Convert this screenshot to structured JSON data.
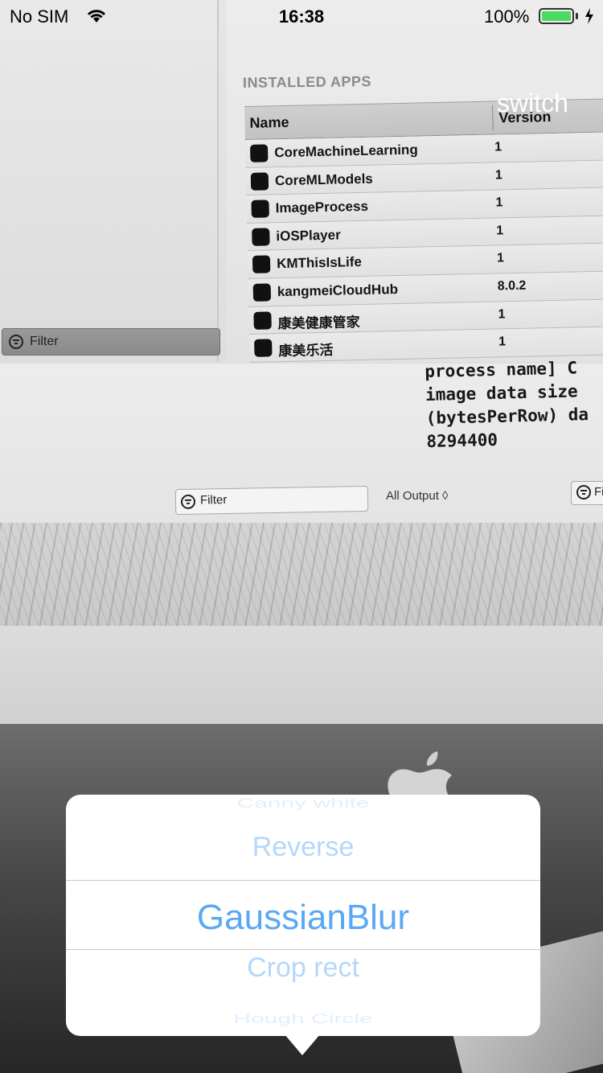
{
  "status_bar": {
    "carrier": "No SIM",
    "time": "16:38",
    "battery_percent": "100%",
    "battery_color": "#4cd964"
  },
  "switch_label": "switch",
  "camera_scene": {
    "section_title": "INSTALLED APPS",
    "table": {
      "columns": [
        "Name",
        "Version"
      ],
      "rows": [
        {
          "name": "CoreMachineLearning",
          "version": "1"
        },
        {
          "name": "CoreMLModels",
          "version": "1"
        },
        {
          "name": "ImageProcess",
          "version": "1"
        },
        {
          "name": "iOSPlayer",
          "version": "1"
        },
        {
          "name": "KMThisIsLife",
          "version": "1"
        },
        {
          "name": "kangmeiCloudHub",
          "version": "8.0.2"
        },
        {
          "name": "康美健康管家",
          "version": "1"
        },
        {
          "name": "康美乐活",
          "version": "1"
        }
      ]
    },
    "filter_left": "Filter",
    "filter_mid": "Filter",
    "filter_right": "Fi",
    "all_output": "All Output ◊",
    "console_lines": [
      "process name] C",
      "image data size",
      "(bytesPerRow) da",
      "8294400"
    ]
  },
  "picker": {
    "accent_color": "#5aa8f5",
    "items": [
      "Canny white",
      "Reverse",
      "GaussianBlur",
      "Crop rect",
      "Hough Circle"
    ],
    "selected": "GaussianBlur"
  }
}
